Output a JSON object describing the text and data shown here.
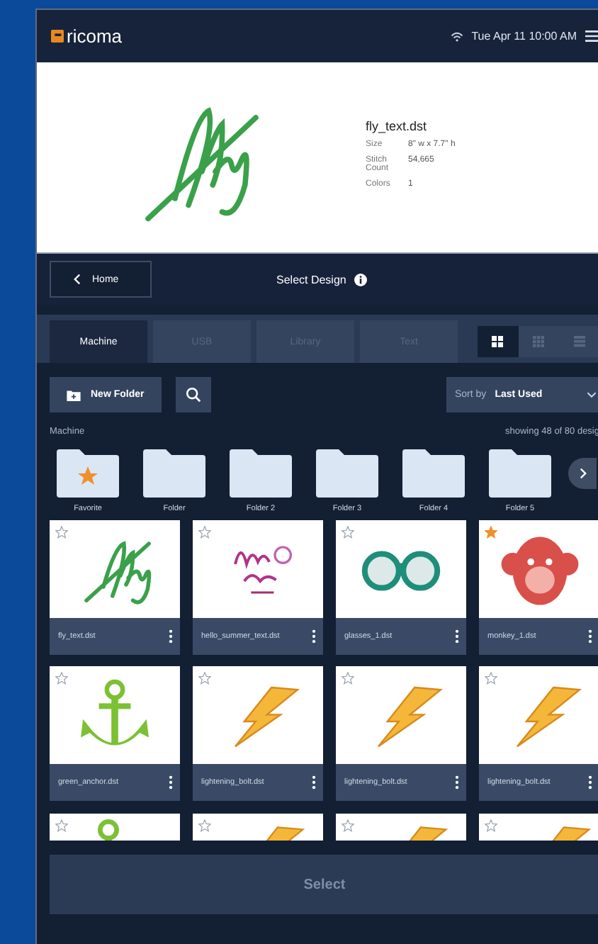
{
  "header": {
    "logo": "ricoma",
    "datetime": "Tue Apr 11  10:00 AM"
  },
  "preview": {
    "kind": "fly",
    "filename": "fly_text.dst",
    "details": [
      {
        "label": "Size",
        "value": "8\" w x 7.7\" h"
      },
      {
        "label": "Stitch Count",
        "value": "54,665"
      },
      {
        "label": "Colors",
        "value": "1"
      }
    ]
  },
  "nav": {
    "back": "Home",
    "title": "Select Design"
  },
  "tabs": [
    {
      "label": "Machine",
      "selected": true
    },
    {
      "label": "USB",
      "selected": false
    },
    {
      "label": "Library",
      "selected": false
    },
    {
      "label": "Text",
      "selected": false
    }
  ],
  "views": [
    {
      "kind": "large",
      "selected": true
    },
    {
      "kind": "small",
      "selected": false
    },
    {
      "kind": "list",
      "selected": false
    }
  ],
  "toolbar": {
    "new_folder": "New Folder",
    "sort_label": "Sort by",
    "sort_value": "Last Used"
  },
  "location": "Machine",
  "count": "showing 48 of 80 desig",
  "folders": [
    {
      "name": "Favorite",
      "favorite": true
    },
    {
      "name": "Folder",
      "favorite": false
    },
    {
      "name": "Folder 2",
      "favorite": false
    },
    {
      "name": "Folder 3",
      "favorite": false
    },
    {
      "name": "Folder 4",
      "favorite": false
    },
    {
      "name": "Folder 5",
      "favorite": false
    }
  ],
  "designs": [
    {
      "name": "fly_text.dst",
      "kind": "fly",
      "starred": false
    },
    {
      "name": "hello_summer_text.dst",
      "kind": "hello",
      "starred": false
    },
    {
      "name": "glasses_1.dst",
      "kind": "glasses",
      "starred": false
    },
    {
      "name": "monkey_1.dst",
      "kind": "monkey",
      "starred": true
    },
    {
      "name": "green_anchor.dst",
      "kind": "anchor",
      "starred": false
    },
    {
      "name": "lightening_bolt.dst",
      "kind": "bolt",
      "starred": false
    },
    {
      "name": "lightening_bolt.dst",
      "kind": "bolt",
      "starred": false
    },
    {
      "name": "lightening_bolt.dst",
      "kind": "bolt",
      "starred": false
    },
    {
      "kind": "anchor",
      "starred": false
    },
    {
      "kind": "bolt",
      "starred": false
    },
    {
      "kind": "bolt",
      "starred": false
    },
    {
      "kind": "bolt",
      "starred": false
    }
  ],
  "select_button": "Select"
}
